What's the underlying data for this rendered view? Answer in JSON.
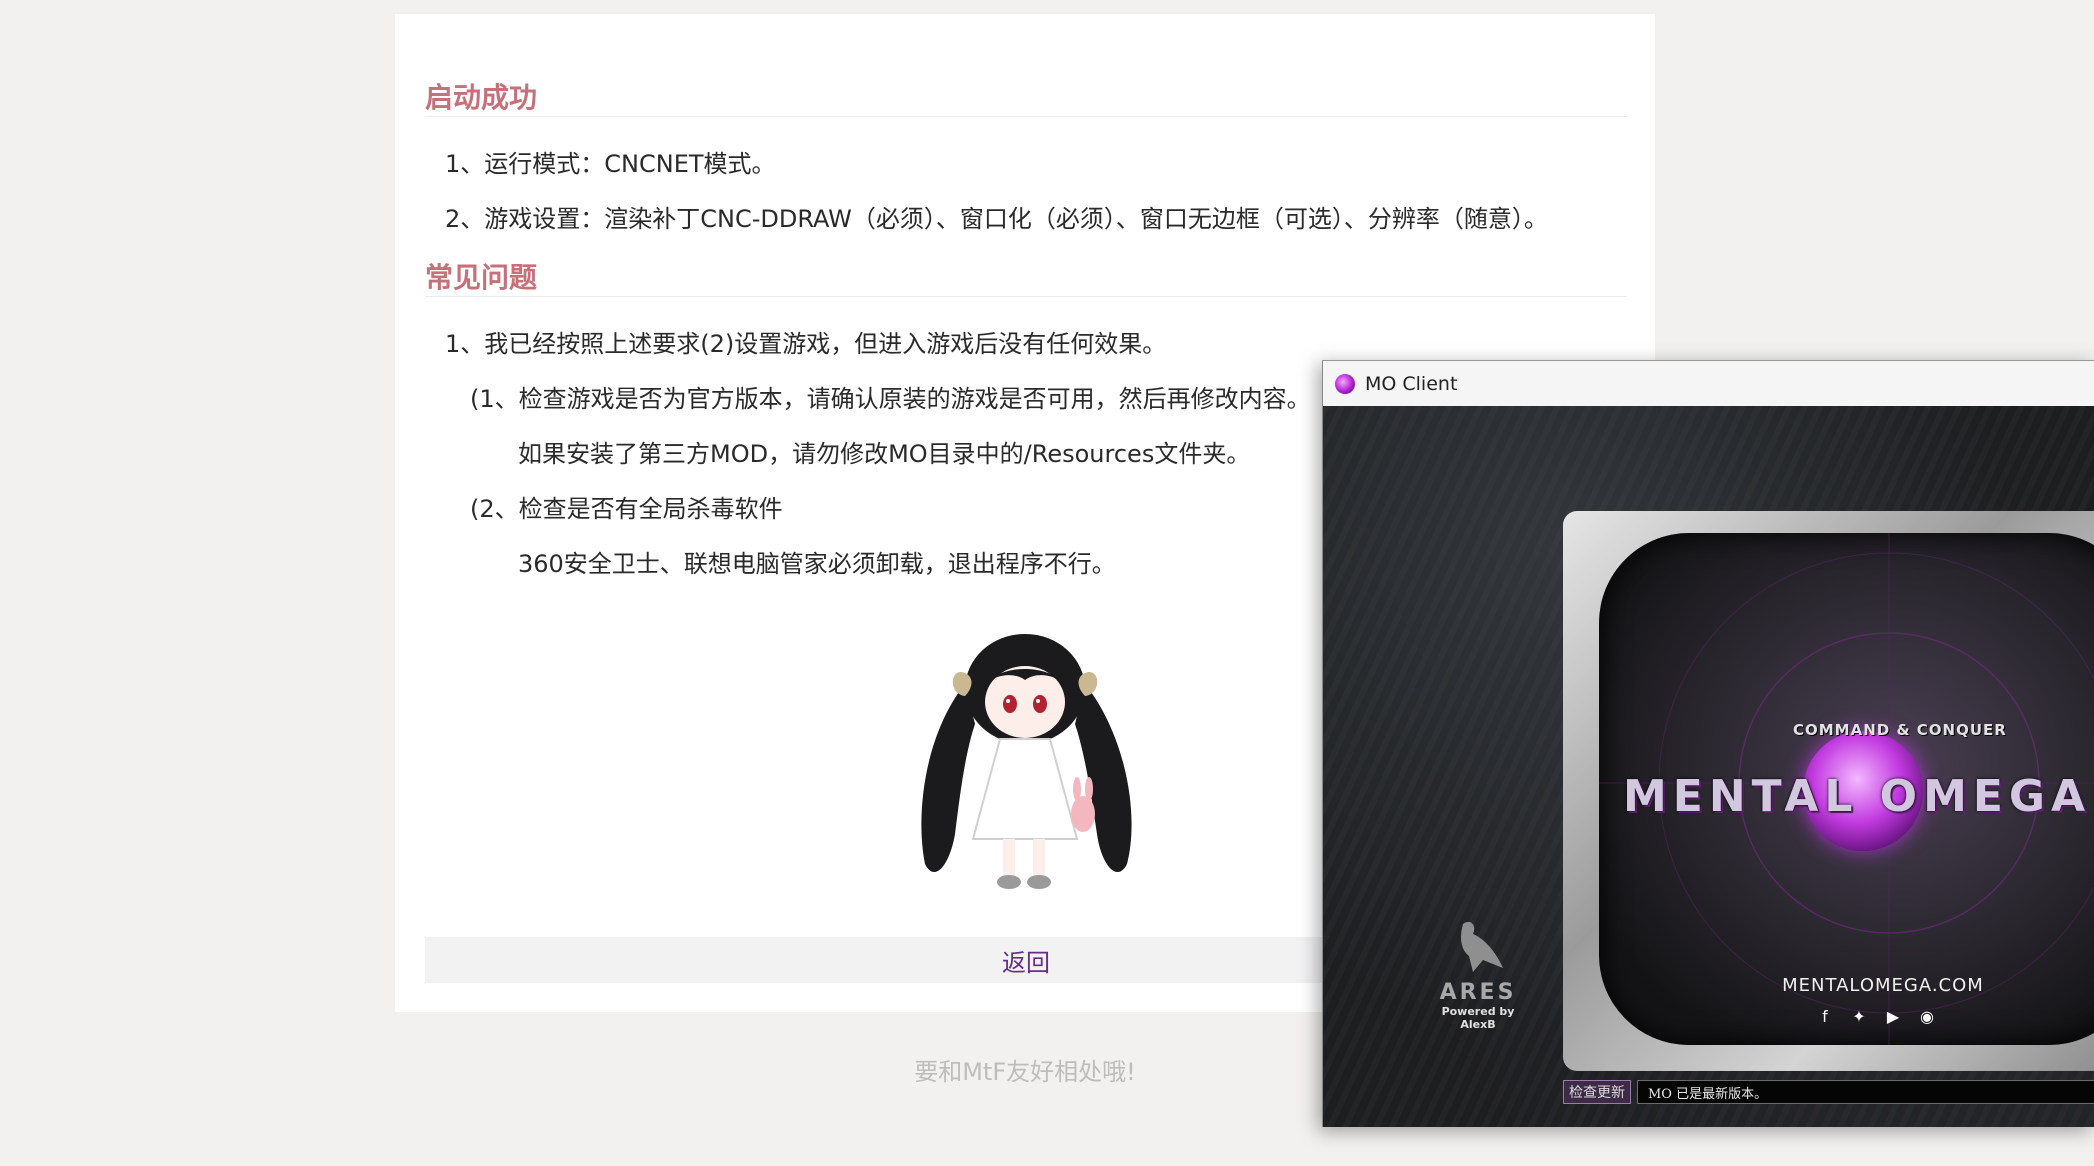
{
  "sections": {
    "launch_success": {
      "title": "启动成功",
      "items": [
        "1、运行模式：CNCNET模式。",
        "2、游戏设置：渲染补丁CNC-DDRAW（必须）、窗口化（必须）、窗口无边框（可选）、分辨率（随意）。"
      ]
    },
    "faq": {
      "title": "常见问题",
      "question": "1、我已经按照上述要求(2)设置游戏，但进入游戏后没有任何效果。",
      "answer1": "(1、检查游戏是否为官方版本，请确认原装的游戏是否可用，然后再修改内容。",
      "answer1_note": "如果安装了第三方MOD，请勿修改MO目录中的/Resources文件夹。",
      "answer2": "(2、检查是否有全局杀毒软件",
      "answer2_note": "360安全卫士、联想电脑管家必须卸载，退出程序不行。"
    }
  },
  "return_button": "返回",
  "footer": "要和MtF友好相处哦!",
  "mo_client": {
    "title": "MO Client",
    "logo_top": "COMMAND & CONQUER",
    "logo_main": "MENTAL OMEGA",
    "url": "MENTALOMEGA.COM",
    "social_icons": [
      "facebook-icon",
      "twitter-icon",
      "youtube-icon",
      "discord-icon"
    ],
    "ares_label": "ARES",
    "ares_powered": "Powered by AlexB",
    "update_button": "检查更新",
    "status_text": "MO 已是最新版本。"
  },
  "colors": {
    "section_title": "#c8707a",
    "link": "#6a2b8c",
    "footer_text": "#bdbdbd"
  }
}
